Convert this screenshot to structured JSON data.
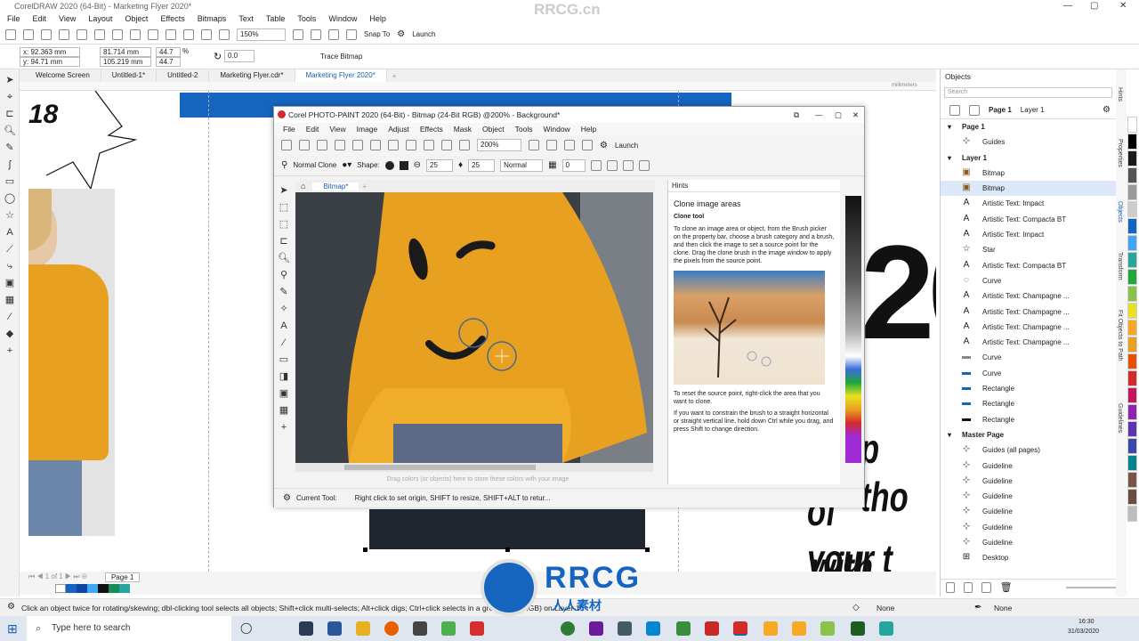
{
  "app": {
    "title": "CorelDRAW 2020 (64-Bit) - Marketing Flyer 2020*",
    "menu": [
      "File",
      "Edit",
      "View",
      "Layout",
      "Object",
      "Effects",
      "Bitmaps",
      "Text",
      "Table",
      "Tools",
      "Window",
      "Help"
    ],
    "watermark": "RRCG.cn"
  },
  "std_toolbar": {
    "zoom": "150%",
    "snap_to": "Snap To",
    "launch": "Launch"
  },
  "prop_bar": {
    "x": "x: 92.363 mm",
    "y": "y: 94.71 mm",
    "w": "81.714 mm",
    "h": "105.219 mm",
    "sx": "44.7",
    "sy": "44.7",
    "pct": "%",
    "angle": "0.0",
    "trace": "Trace Bitmap"
  },
  "doc_tabs": [
    "Welcome Screen",
    "Untitled-1*",
    "Untitled-2",
    "Marketing Flyer.cdr*",
    "Marketing Flyer 2020*"
  ],
  "ruler_unit": "millimeters",
  "canvas": {
    "number": "18",
    "big_number": "20",
    "line1": "p tho",
    "line2": "of your t",
    "line3": "with non"
  },
  "page_tab": "Page 1",
  "status_hint": "Click an object twice for rotating/skewing; dbl-clicking tool selects all objects; Shift+click multi-selects; Alt+click digs; Ctrl+click selects in a group",
  "status_mid": "Bitmap (RGB) on Layer 1",
  "status_fill": "None",
  "status_outline": "None",
  "docker": {
    "title": "Objects",
    "search_placeholder": "Search",
    "page": "Page 1",
    "layer": "Layer 1",
    "items": [
      {
        "label": "Page 1",
        "type": "head"
      },
      {
        "label": "Guides",
        "icon": "guides"
      },
      {
        "label": "Layer 1",
        "type": "head"
      },
      {
        "label": "Bitmap",
        "icon": "bitmap"
      },
      {
        "label": "Bitmap",
        "icon": "bitmap",
        "selected": true
      },
      {
        "label": "Artistic Text: Impact",
        "icon": "text"
      },
      {
        "label": "Artistic Text: Compacta BT",
        "icon": "text"
      },
      {
        "label": "Artistic Text: Impact",
        "icon": "text"
      },
      {
        "label": "Star",
        "icon": "star"
      },
      {
        "label": "Artistic Text: Compacta BT",
        "icon": "text"
      },
      {
        "label": "Curve",
        "icon": "curve"
      },
      {
        "label": "Artistic Text: Champagne ...",
        "icon": "text"
      },
      {
        "label": "Artistic Text: Champagne ...",
        "icon": "text"
      },
      {
        "label": "Artistic Text: Champagne ...",
        "icon": "text"
      },
      {
        "label": "Artistic Text: Champagne ...",
        "icon": "text"
      },
      {
        "label": "Curve",
        "icon": "curve-gray"
      },
      {
        "label": "Curve",
        "icon": "curve-blue"
      },
      {
        "label": "Rectangle",
        "icon": "rect-blue"
      },
      {
        "label": "Rectangle",
        "icon": "rect-blue"
      },
      {
        "label": "Rectangle",
        "icon": "rect-dark"
      },
      {
        "label": "Master Page",
        "type": "head"
      },
      {
        "label": "Guides (all pages)",
        "icon": "guides"
      },
      {
        "label": "Guideline",
        "icon": "guides"
      },
      {
        "label": "Guideline",
        "icon": "guides"
      },
      {
        "label": "Guideline",
        "icon": "guides"
      },
      {
        "label": "Guideline",
        "icon": "guides"
      },
      {
        "label": "Guideline",
        "icon": "guides"
      },
      {
        "label": "Guideline",
        "icon": "guides"
      },
      {
        "label": "Desktop",
        "icon": "desktop"
      }
    ]
  },
  "side_tabs": [
    "Hints",
    "Properties",
    "Objects",
    "Transform",
    "Fit Objects to Path",
    "Guidelines"
  ],
  "photopaint": {
    "title": "Corel PHOTO-PAINT 2020 (64-Bit) - Bitmap (24-Bit RGB) @200% - Background*",
    "menu": [
      "File",
      "Edit",
      "View",
      "Image",
      "Adjust",
      "Effects",
      "Mask",
      "Object",
      "Tools",
      "Window",
      "Help"
    ],
    "zoom": "200%",
    "launch": "Launch",
    "clone_mode": "Normal Clone",
    "shape_label": "Shape:",
    "size": "25",
    "transparency": "25",
    "merge": "Normal",
    "feather": "0",
    "image_tab": "Bitmap*",
    "palette_hint": "Drag colors (or objects) here to store these colors with your image",
    "status_label": "Current Tool:",
    "status_text": "Right click to set origin, SHIFT to resize, SHIFT+ALT to retur...",
    "hints": {
      "title": "Hints",
      "heading": "Clone image areas",
      "tool": "Clone tool",
      "p1": "To clone an image area or object, from the Brush picker on the property bar, choose a brush category and a brush, and then click the image to set a source point for the clone. Drag the clone brush in the image window to apply the pixels from the source point.",
      "p2": "To reset the source point, right-click the area that you want to clone.",
      "p3": "If you want to constrain the brush to a straight horizontal or straight vertical line, hold down Ctrl while you drag, and press Shift to change direction."
    }
  },
  "taskbar": {
    "search": "Type here to search",
    "time": "16:30",
    "date": "31/03/2020"
  },
  "logo": {
    "brand": "RRCG",
    "sub": "人人素材"
  },
  "colors": {
    "corel_blue": "#1565c0",
    "hoodie": "#e8a020",
    "accent": "#1a5fb4"
  }
}
